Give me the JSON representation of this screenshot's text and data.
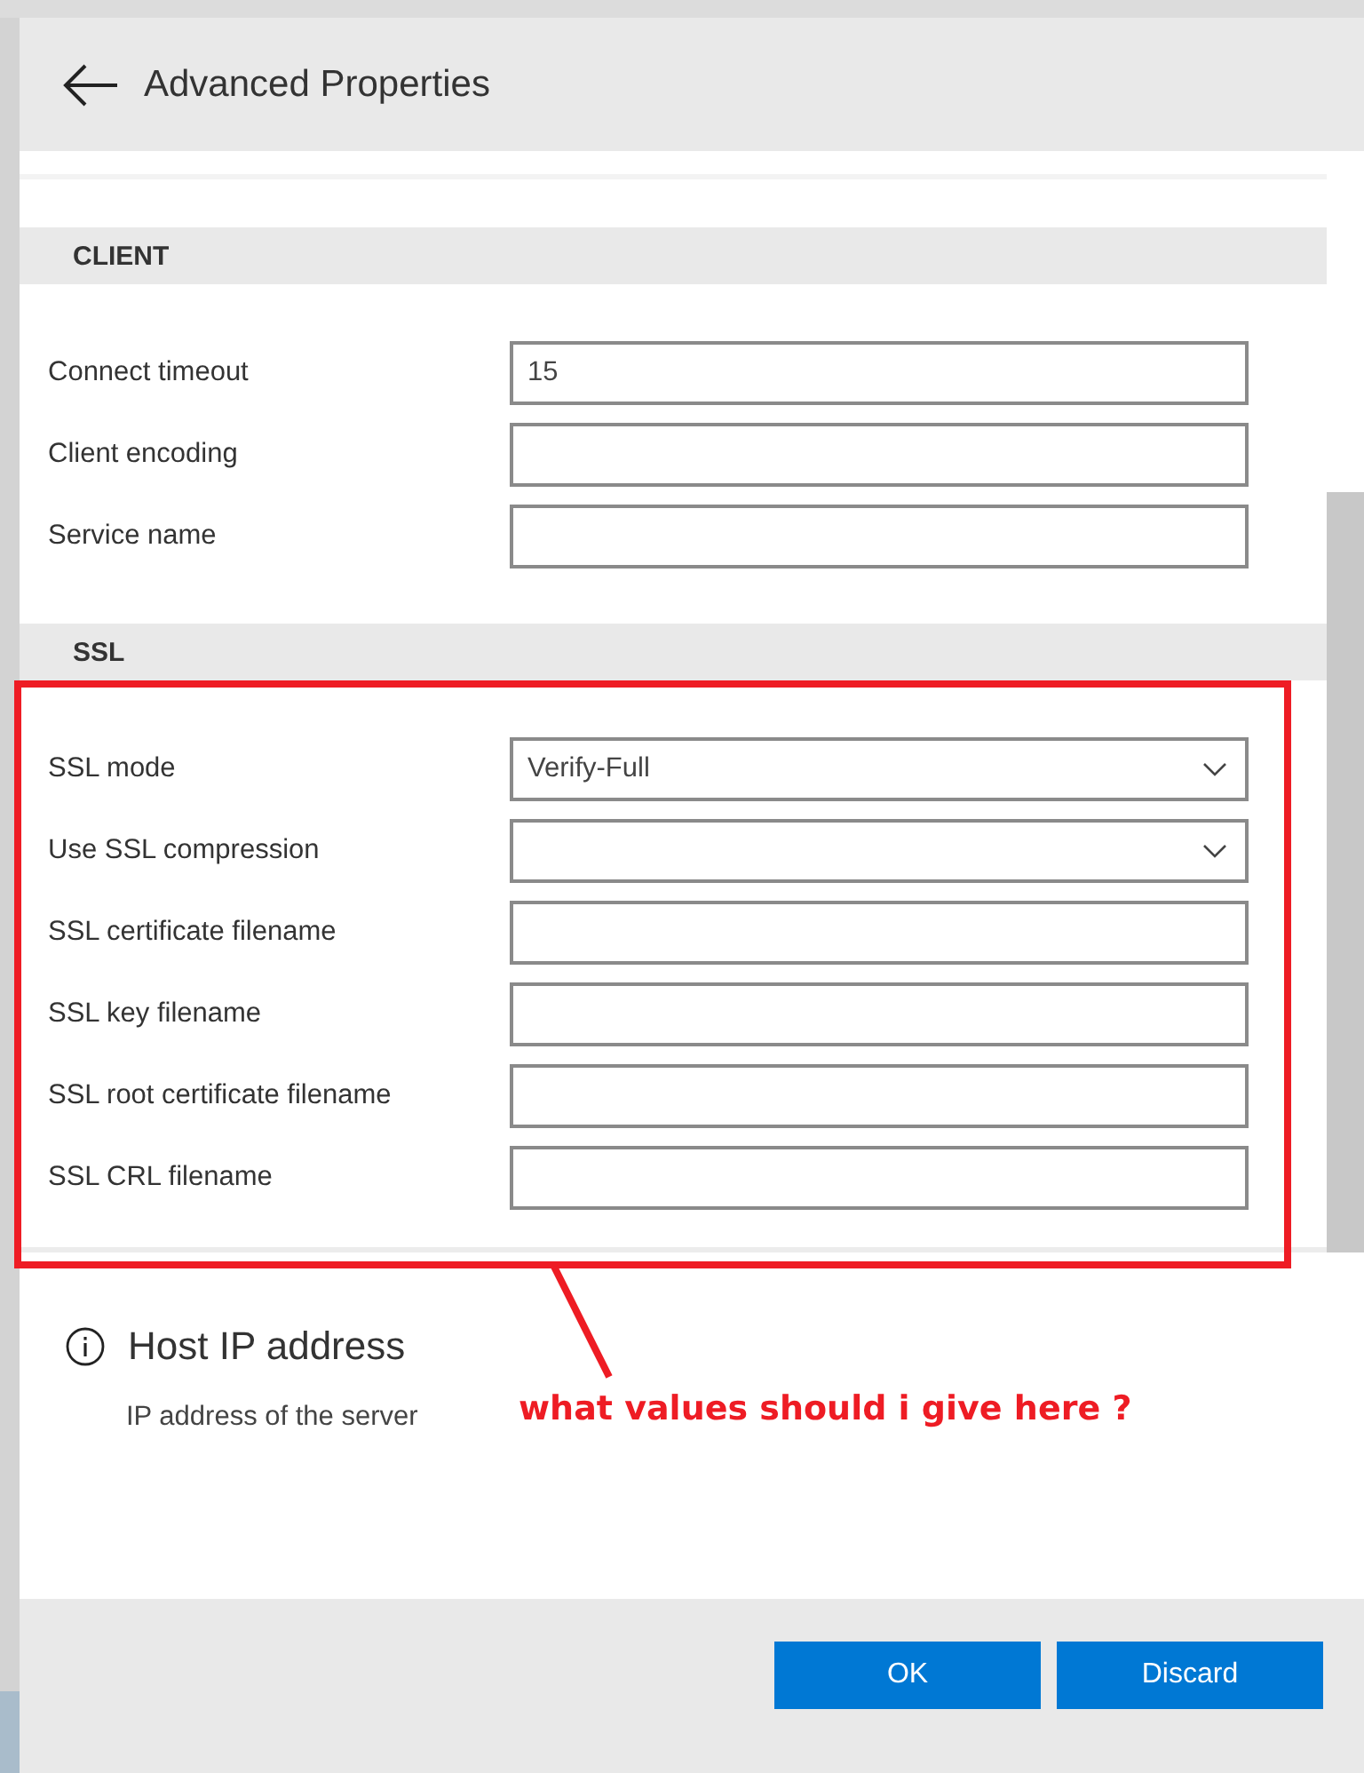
{
  "window": {
    "title": "Advanced Properties"
  },
  "sections": [
    {
      "title": "CLIENT",
      "fields": [
        {
          "label": "Connect timeout",
          "kind": "text",
          "value": "15"
        },
        {
          "label": "Client encoding",
          "kind": "text"
        },
        {
          "label": "Service name",
          "kind": "text"
        }
      ]
    },
    {
      "title": "SSL",
      "fields": [
        {
          "label": "SSL mode",
          "kind": "dropdown",
          "value": "Verify-Full"
        },
        {
          "label": "Use SSL compression",
          "kind": "dropdown"
        },
        {
          "label": "SSL certificate filename",
          "kind": "text"
        },
        {
          "label": "SSL key filename",
          "kind": "text"
        },
        {
          "label": "SSL root certificate filename",
          "kind": "text"
        },
        {
          "label": "SSL CRL filename",
          "kind": "text"
        }
      ]
    }
  ],
  "info": {
    "title": "Host IP address",
    "description": "IP address of the server"
  },
  "buttons": [
    {
      "label": "OK"
    },
    {
      "label": "Discard"
    }
  ],
  "annotation": {
    "text": "what values should i give here ?"
  }
}
